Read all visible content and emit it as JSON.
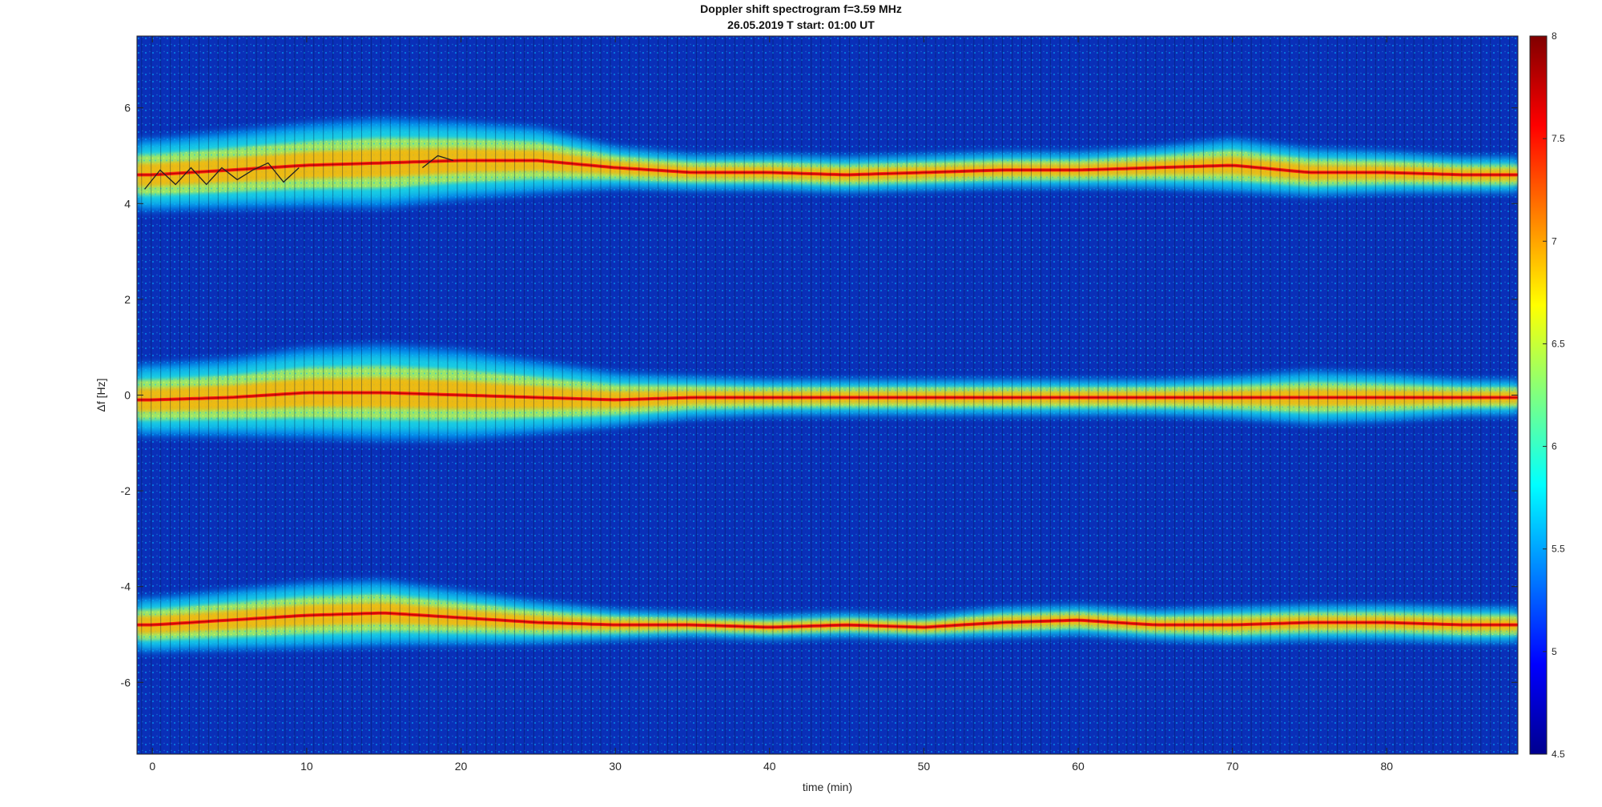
{
  "chart_data": {
    "type": "heatmap",
    "title": "Doppler shift spectrogram f=3.59 MHz",
    "subtitle": "26.05.2019    T start: 01:00 UT",
    "xlabel": "time (min)",
    "ylabel": "Δf [Hz]",
    "xlim": [
      -1,
      88.5
    ],
    "ylim": [
      -7.5,
      7.5
    ],
    "xticks": [
      0,
      10,
      20,
      30,
      40,
      50,
      60,
      70,
      80
    ],
    "yticks": [
      -6,
      -4,
      -2,
      0,
      2,
      4,
      6
    ],
    "colorbar": {
      "colormap": "jet",
      "clim": [
        4.5,
        8
      ],
      "ticks": [
        4.5,
        5,
        5.5,
        6,
        6.5,
        7,
        7.5,
        8
      ]
    },
    "bands": [
      {
        "label": "upper",
        "t": [
          0,
          5,
          10,
          15,
          20,
          25,
          30,
          35,
          40,
          45,
          50,
          55,
          60,
          65,
          70,
          75,
          80,
          85,
          88
        ],
        "f": [
          4.6,
          4.7,
          4.8,
          4.85,
          4.9,
          4.9,
          4.75,
          4.65,
          4.65,
          4.6,
          4.65,
          4.7,
          4.7,
          4.75,
          4.8,
          4.65,
          4.65,
          4.6,
          4.6
        ],
        "halfwidth": [
          0.6,
          0.65,
          0.7,
          0.75,
          0.65,
          0.55,
          0.35,
          0.3,
          0.3,
          0.3,
          0.3,
          0.3,
          0.3,
          0.35,
          0.45,
          0.4,
          0.35,
          0.3,
          0.3
        ]
      },
      {
        "label": "center",
        "t": [
          0,
          5,
          10,
          15,
          20,
          25,
          30,
          35,
          40,
          45,
          50,
          55,
          60,
          65,
          70,
          75,
          80,
          85,
          88
        ],
        "f": [
          -0.1,
          -0.05,
          0.05,
          0.05,
          0.0,
          -0.05,
          -0.1,
          -0.05,
          -0.05,
          -0.05,
          -0.05,
          -0.05,
          -0.05,
          -0.05,
          -0.05,
          -0.05,
          -0.05,
          -0.05,
          -0.05
        ],
        "halfwidth": [
          0.6,
          0.65,
          0.75,
          0.8,
          0.75,
          0.6,
          0.45,
          0.35,
          0.3,
          0.3,
          0.3,
          0.3,
          0.3,
          0.3,
          0.35,
          0.45,
          0.4,
          0.3,
          0.3
        ]
      },
      {
        "label": "lower",
        "t": [
          0,
          5,
          10,
          15,
          20,
          25,
          30,
          35,
          40,
          45,
          50,
          55,
          60,
          65,
          70,
          75,
          80,
          85,
          88
        ],
        "f": [
          -4.8,
          -4.7,
          -4.6,
          -4.55,
          -4.65,
          -4.75,
          -4.8,
          -4.8,
          -4.85,
          -4.8,
          -4.85,
          -4.75,
          -4.7,
          -4.8,
          -4.8,
          -4.75,
          -4.75,
          -4.8,
          -4.8
        ],
        "halfwidth": [
          0.45,
          0.5,
          0.55,
          0.55,
          0.45,
          0.35,
          0.25,
          0.2,
          0.2,
          0.2,
          0.2,
          0.25,
          0.25,
          0.25,
          0.3,
          0.3,
          0.3,
          0.3,
          0.3
        ]
      }
    ],
    "trace_segments": [
      {
        "color": "#222222",
        "t": [
          -0.5,
          0.5,
          1.5,
          2.5,
          3.5,
          4.5,
          5.5,
          6.5,
          7.5,
          8.5,
          9.5
        ],
        "f": [
          4.3,
          4.7,
          4.4,
          4.75,
          4.4,
          4.75,
          4.5,
          4.7,
          4.85,
          4.45,
          4.75
        ]
      },
      {
        "color": "#222222",
        "t": [
          17.5,
          18.5,
          19.5
        ],
        "f": [
          4.75,
          5.0,
          4.9
        ]
      }
    ]
  }
}
